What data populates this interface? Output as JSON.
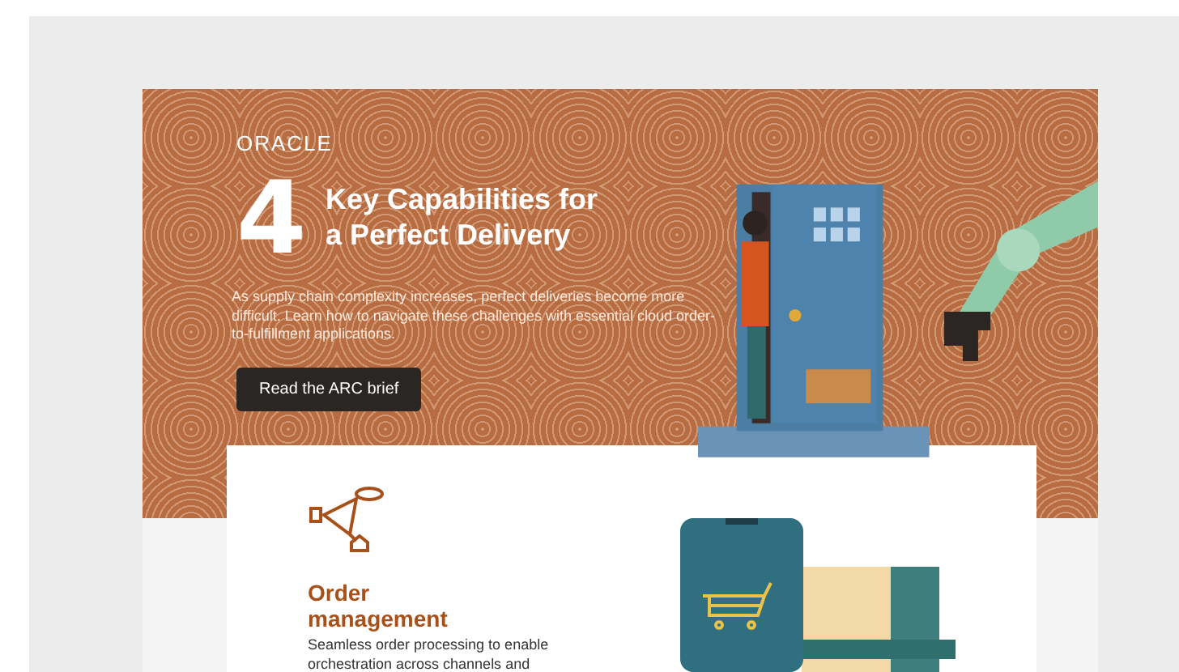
{
  "brand": "ORACLE",
  "hero": {
    "number": "4",
    "title_lines": [
      "Key Capabilities for",
      "a Perfect Delivery"
    ],
    "intro": "As supply chain complexity increases, perfect deliveries become more difficult. Learn how to navigate these challenges with essential cloud order-to-fulfillment applications.",
    "button": "Read the ARC brief"
  },
  "capability": {
    "title_lines": [
      "Order",
      "management"
    ],
    "description_lines": [
      "Seamless order processing to enable",
      "orchestration across channels and"
    ]
  }
}
